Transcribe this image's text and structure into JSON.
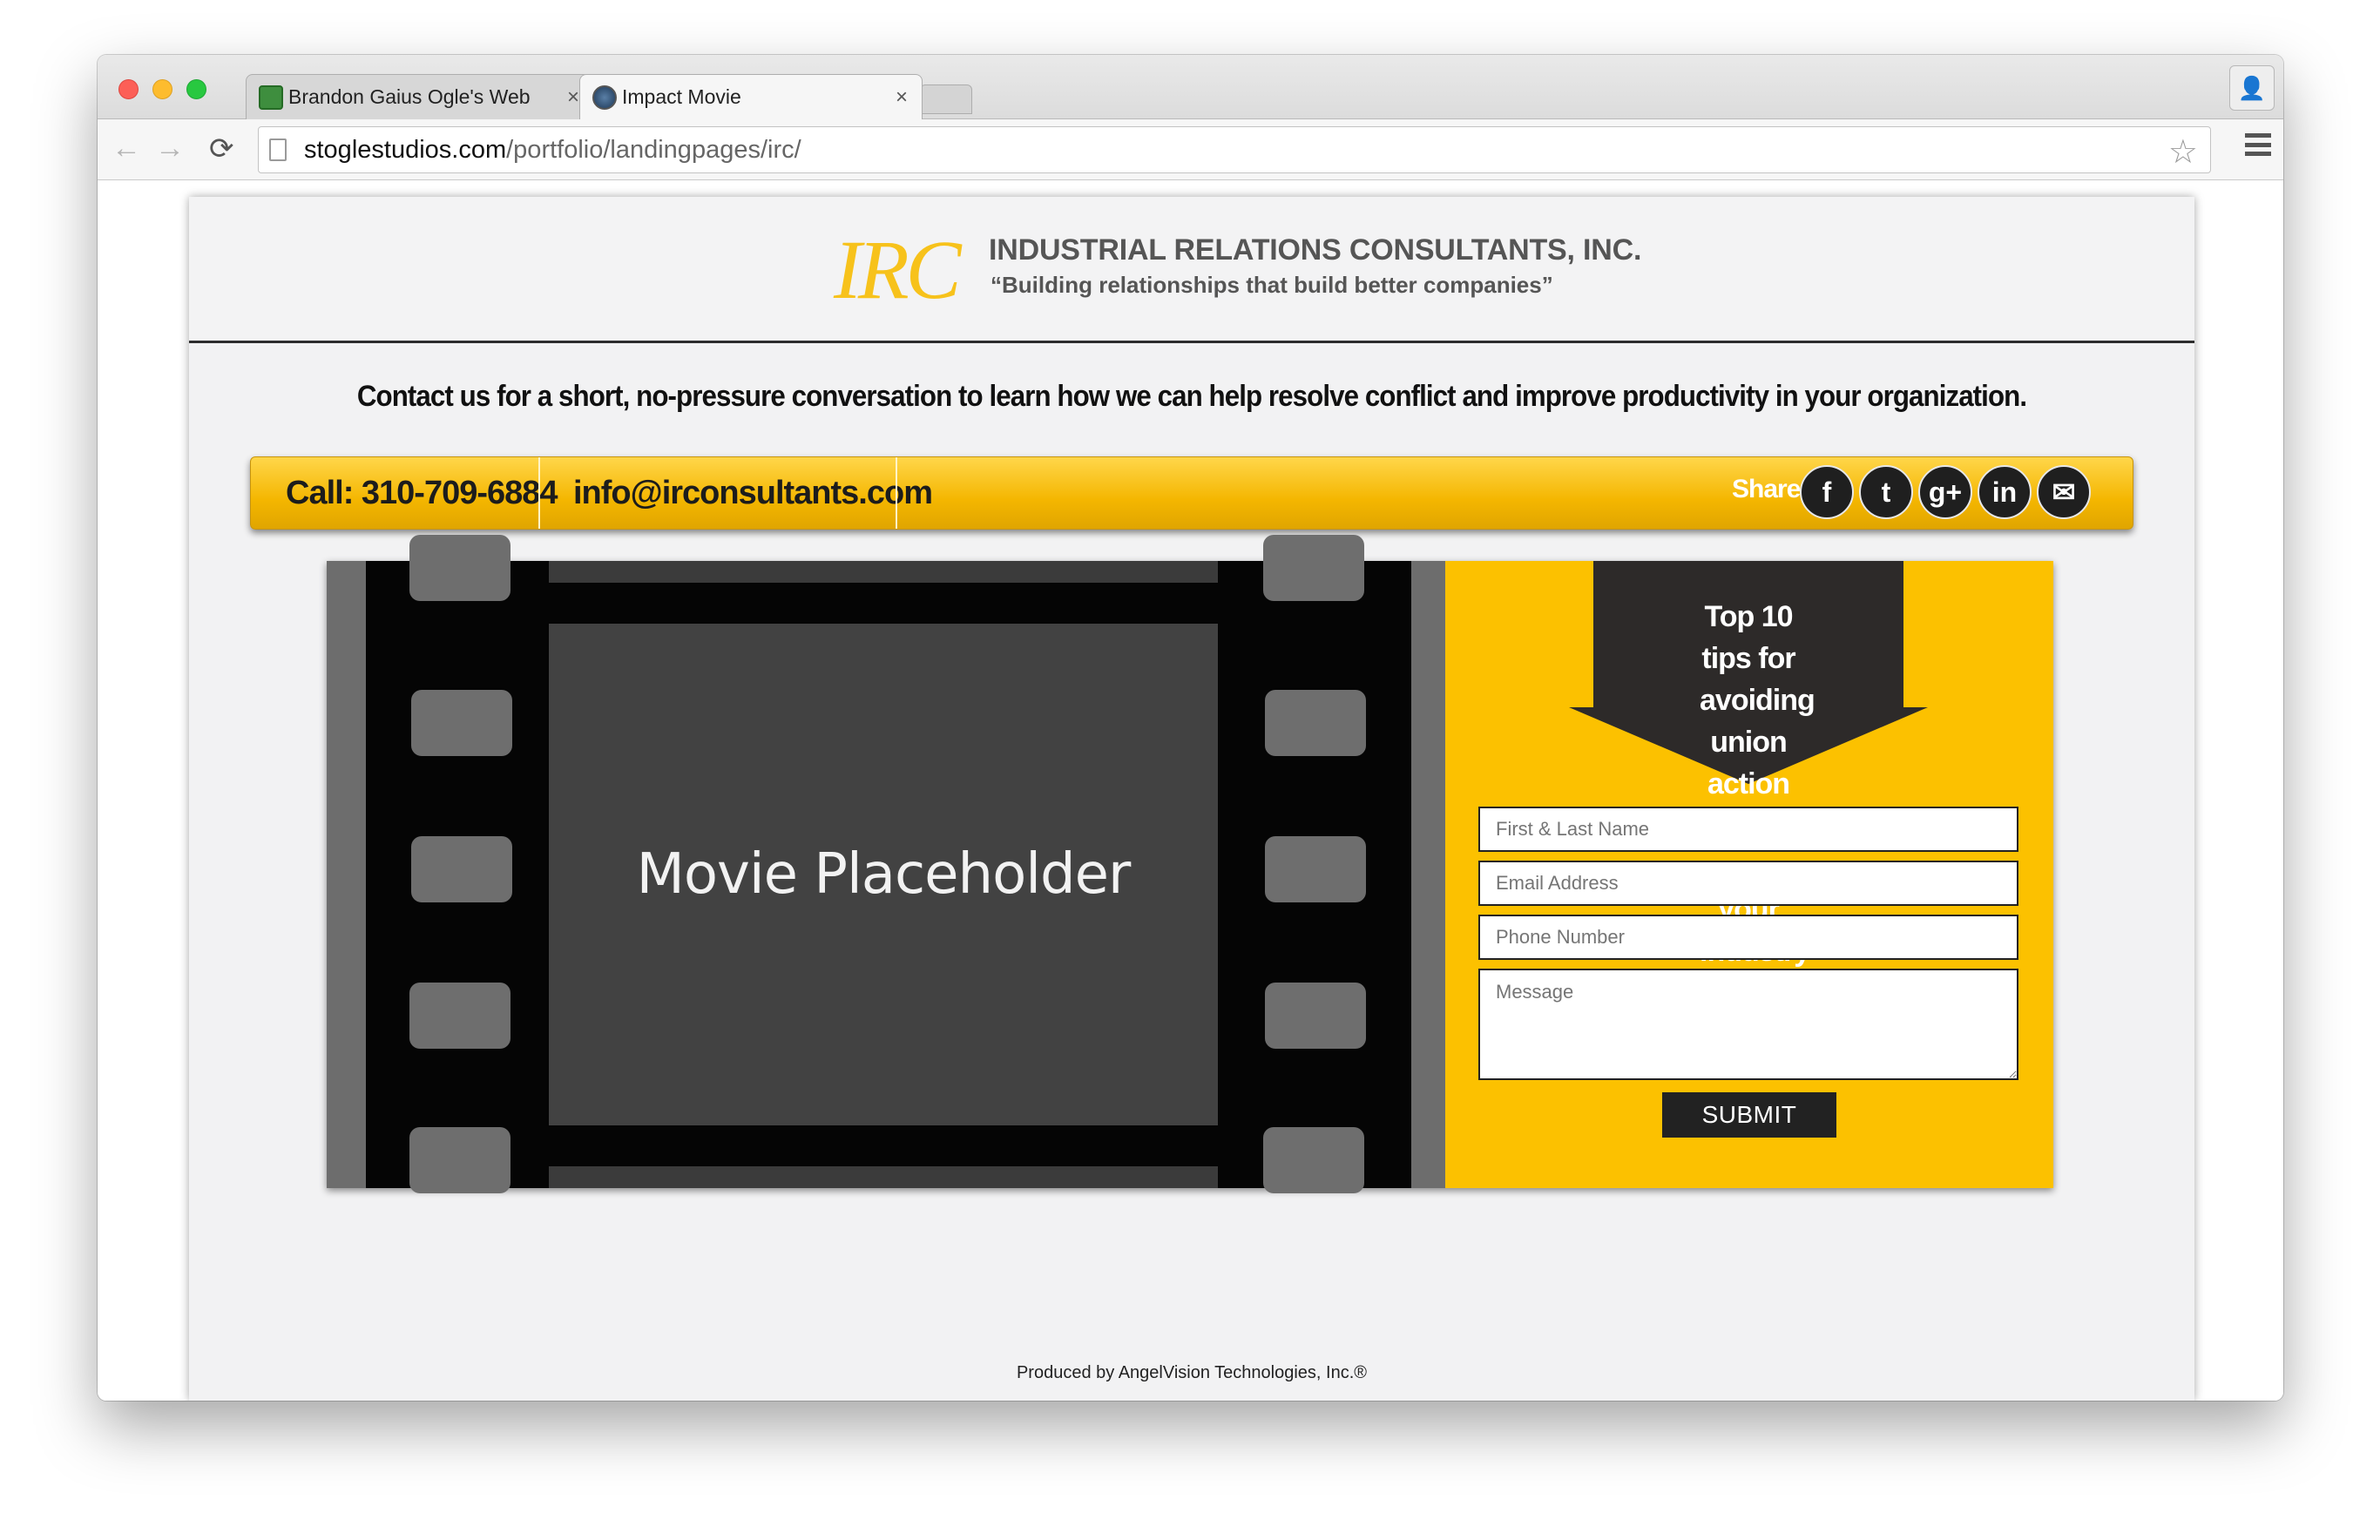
{
  "browser": {
    "tabs": [
      {
        "label": "Brandon Gaius Ogle's Web",
        "close": "×"
      },
      {
        "label": "Impact Movie",
        "close": "×"
      }
    ],
    "url_host": "stoglestudios.com",
    "url_path": "/portfolio/landingpages/irc/",
    "back": "←",
    "forward": "→",
    "reload": "⟳",
    "star": "☆",
    "profile": "👤"
  },
  "header": {
    "logo_text": "IRC",
    "company": "INDUSTRIAL RELATIONS CONSULTANTS, INC.",
    "tagline": "“Building relationships that build better companies”"
  },
  "headline": "Contact us for a short, no-pressure conversation to learn how we can help resolve conflict and improve productivity in your organization.",
  "contact_bar": {
    "call": "Call: 310-709-6884",
    "email": "info@irconsultants.com",
    "share_label": "Share:",
    "social": [
      {
        "name": "facebook-icon",
        "glyph": "f"
      },
      {
        "name": "twitter-icon",
        "glyph": "t"
      },
      {
        "name": "google-plus-icon",
        "glyph": "g+"
      },
      {
        "name": "linkedin-icon",
        "glyph": "in"
      },
      {
        "name": "email-icon",
        "glyph": "✉"
      }
    ]
  },
  "hero": {
    "movie_placeholder": "Movie Placeholder",
    "form_title": "Top 10 tips for avoiding union action based on your industry",
    "fields": {
      "name_placeholder": "First & Last Name",
      "email_placeholder": "Email Address",
      "phone_placeholder": "Phone Number",
      "message_placeholder": "Message"
    },
    "submit": "SUBMIT"
  },
  "footer": "Produced by AngelVision Technologies, Inc.®",
  "colors": {
    "accent": "#fcc100",
    "dark": "#222222"
  }
}
